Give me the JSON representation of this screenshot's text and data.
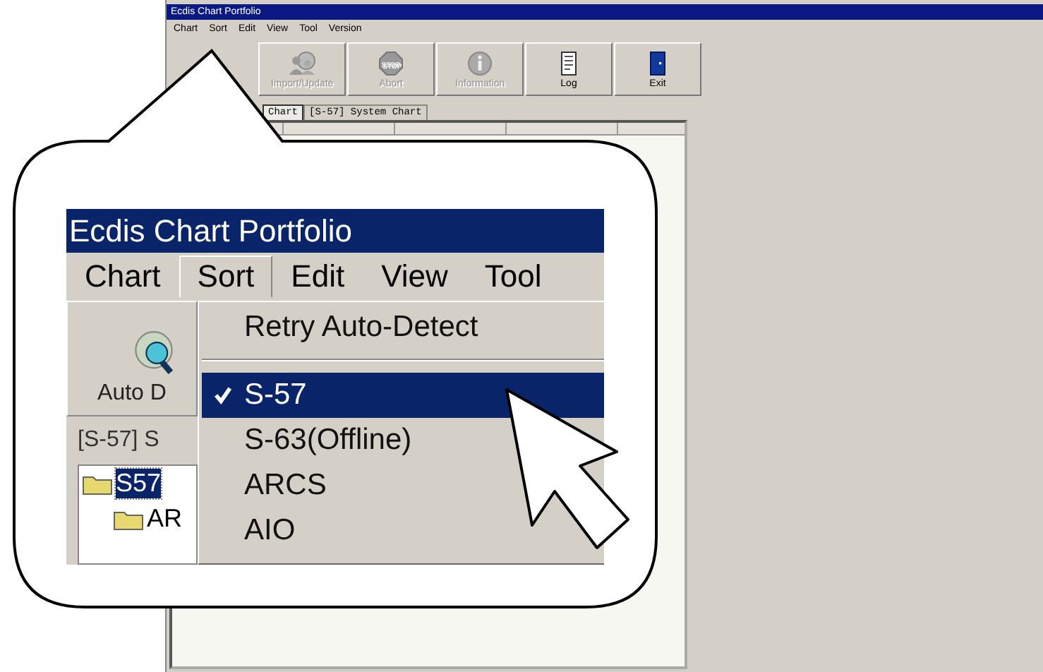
{
  "window": {
    "title": "Ecdis Chart Portfolio"
  },
  "menu": [
    {
      "label": "Chart"
    },
    {
      "label": "Sort"
    },
    {
      "label": "Edit"
    },
    {
      "label": "View"
    },
    {
      "label": "Tool"
    },
    {
      "label": "Version"
    }
  ],
  "toolbar": [
    {
      "kind": "update",
      "label": "Import/Update",
      "disabled": true
    },
    {
      "kind": "stop",
      "label": "Abort",
      "badge": "STOP",
      "disabled": true
    },
    {
      "kind": "info",
      "label": "Information",
      "disabled": true
    },
    {
      "kind": "log",
      "label": "Log",
      "disabled": false
    },
    {
      "kind": "exit",
      "label": "Exit",
      "disabled": false
    }
  ],
  "tabs": [
    {
      "label": "Chart",
      "selected": true
    },
    {
      "label": "[S-57] System Chart",
      "selected": false
    }
  ],
  "callout": {
    "title": "Ecdis Chart Portfolio",
    "menu": [
      {
        "label": "Chart",
        "selected": false
      },
      {
        "label": "Sort",
        "selected": true
      },
      {
        "label": "Edit",
        "selected": false
      },
      {
        "label": "View",
        "selected": false
      },
      {
        "label": "Tool",
        "selected": false
      }
    ],
    "button": {
      "label": "Auto D"
    },
    "tab": {
      "label": "[S-57] S"
    },
    "tree": [
      {
        "label": "S57",
        "selected": true,
        "children": [
          {
            "label": "AR",
            "selected": false
          }
        ]
      }
    ],
    "dropdown": [
      {
        "kind": "command",
        "label": "Retry Auto-Detect"
      },
      {
        "kind": "separator"
      },
      {
        "kind": "option",
        "label": "S-57",
        "checked": true,
        "selected": true
      },
      {
        "kind": "option",
        "label": "S-63(Offline)",
        "checked": false,
        "selected": false
      },
      {
        "kind": "option",
        "label": "ARCS",
        "checked": false,
        "selected": false
      },
      {
        "kind": "option",
        "label": "AIO",
        "checked": false,
        "selected": false
      }
    ]
  }
}
